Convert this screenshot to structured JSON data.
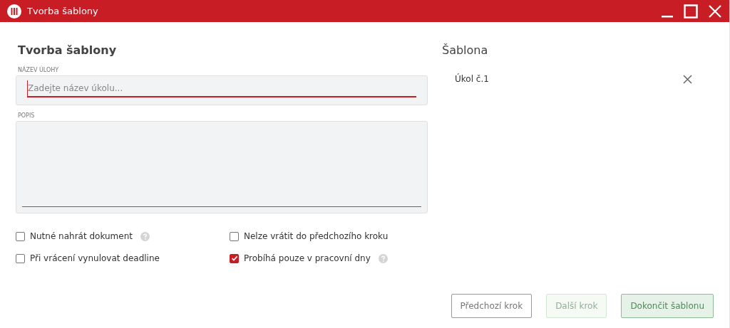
{
  "window": {
    "title": "Tvorba šablony"
  },
  "form": {
    "heading": "Tvorba šablony",
    "name_field": {
      "label": "NÁZEV ÚLOHY",
      "placeholder": "Zadejte název úkolu...",
      "focused": true
    },
    "description_field": {
      "label": "POPIS"
    },
    "options": [
      {
        "label": "Nutné nahrát dokument",
        "checked": false,
        "help": true
      },
      {
        "label": "Nelze vrátit do předchozího kroku",
        "checked": false,
        "help": false
      },
      {
        "label": "Při vrácení vynulovat deadline",
        "checked": false,
        "help": false
      },
      {
        "label": "Probíhá pouze v pracovní dny",
        "checked": true,
        "help": true
      }
    ]
  },
  "template": {
    "heading": "Šablona",
    "items": [
      {
        "label": "Úkol č.1"
      }
    ]
  },
  "buttons": [
    {
      "label": "Předchozí krok",
      "kind": "outline",
      "disabled": false
    },
    {
      "label": "Další krok",
      "kind": "primary",
      "disabled": true
    },
    {
      "label": "Dokončit šablonu",
      "kind": "primary",
      "disabled": false
    }
  ]
}
